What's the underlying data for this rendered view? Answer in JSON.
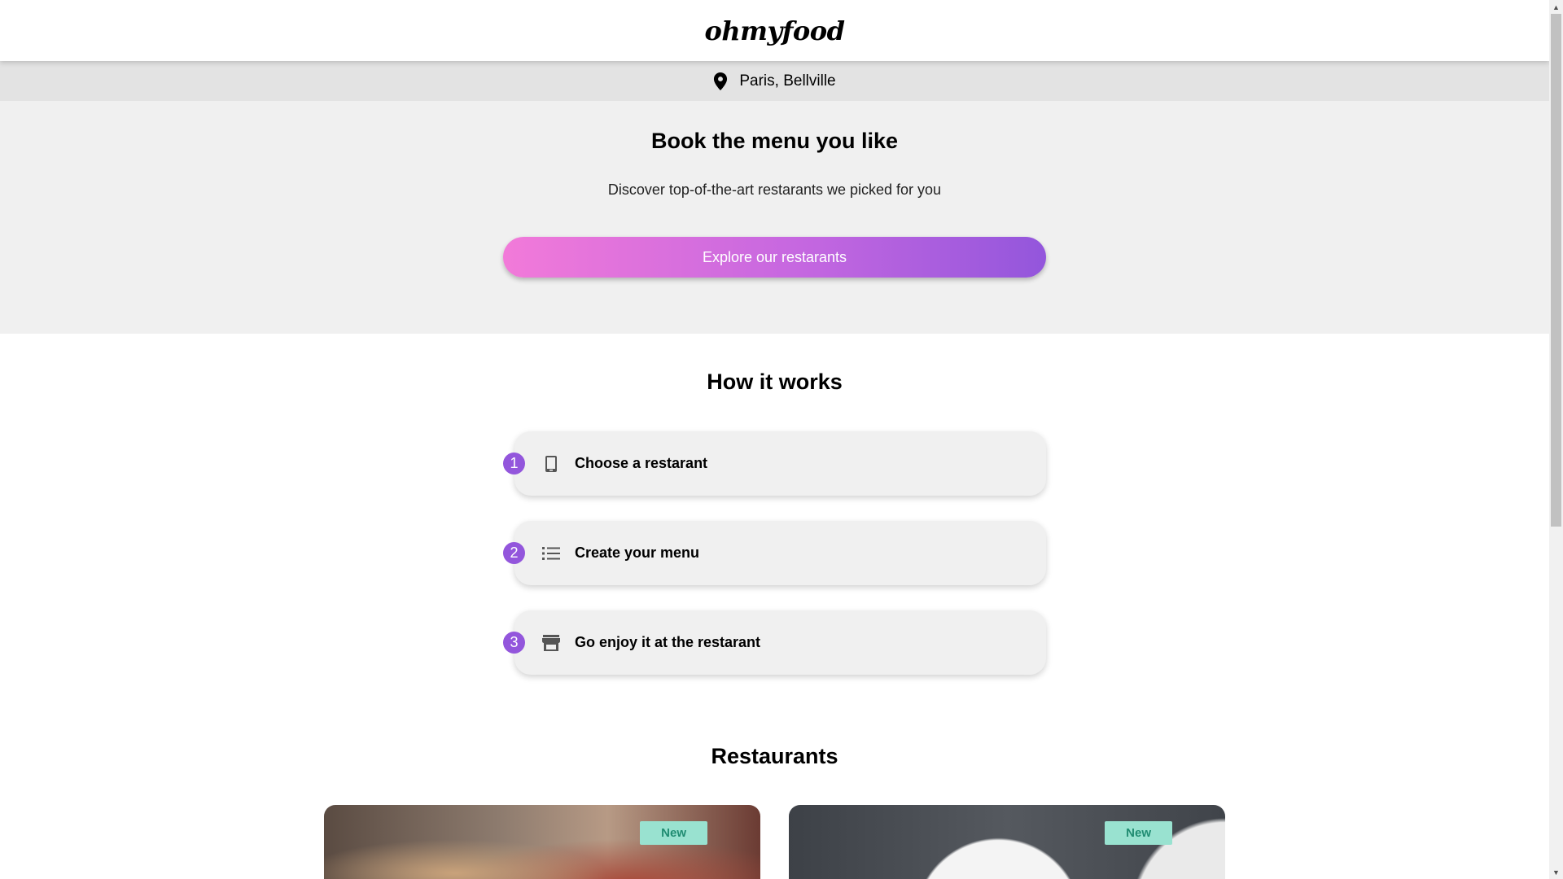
{
  "header": {
    "logo": "ohmyfood"
  },
  "location": {
    "icon": "map-pin-icon",
    "text": "Paris, Bellville"
  },
  "hero": {
    "title": "Book the menu you like",
    "subtitle": "Discover top-of-the-art restarants we picked for you",
    "cta_label": "Explore our restarants"
  },
  "how": {
    "title": "How it works",
    "steps": [
      {
        "number": "1",
        "icon": "smartphone-icon",
        "label": "Choose a restarant"
      },
      {
        "number": "2",
        "icon": "list-icon",
        "label": "Create your menu"
      },
      {
        "number": "3",
        "icon": "store-icon",
        "label": "Go enjoy it at the restarant"
      }
    ]
  },
  "restaurants": {
    "title": "Restaurants",
    "cards": [
      {
        "badge": "New"
      },
      {
        "badge": "New"
      }
    ]
  },
  "colors": {
    "accent": "#9356dc",
    "gradient_start": "#f27ad9",
    "badge_bg": "#99e2d0",
    "badge_text": "#208c72"
  }
}
